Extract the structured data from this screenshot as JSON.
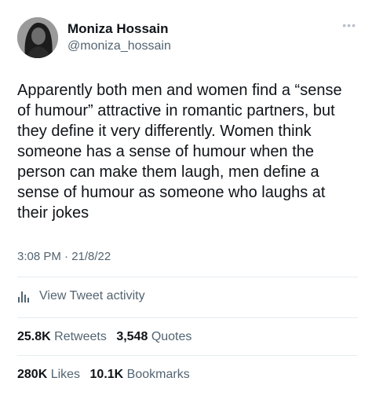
{
  "user": {
    "display_name": "Moniza Hossain",
    "handle": "@moniza_hossain"
  },
  "more_icon": "ellipsis-icon",
  "tweet": {
    "text": "Apparently both men and women find a “sense\nof humour” attractive in romantic partners, but\nthey define it very differently. Women think\nsomeone has a sense of humour when the\nperson can make them laugh, men define a\nsense of humour as someone who laughs at\ntheir jokes",
    "timestamp": "3:08 PM · 21/8/22"
  },
  "activity": {
    "icon": "bar-chart-icon",
    "label": "View Tweet activity"
  },
  "stats": {
    "retweets_count": "25.8K",
    "retweets_label": "Retweets",
    "quotes_count": "3,548",
    "quotes_label": "Quotes",
    "likes_count": "280K",
    "likes_label": "Likes",
    "bookmarks_count": "10.1K",
    "bookmarks_label": "Bookmarks"
  },
  "colors": {
    "text_primary": "#0f1419",
    "text_secondary": "#536471",
    "divider": "#e6ecf0"
  }
}
